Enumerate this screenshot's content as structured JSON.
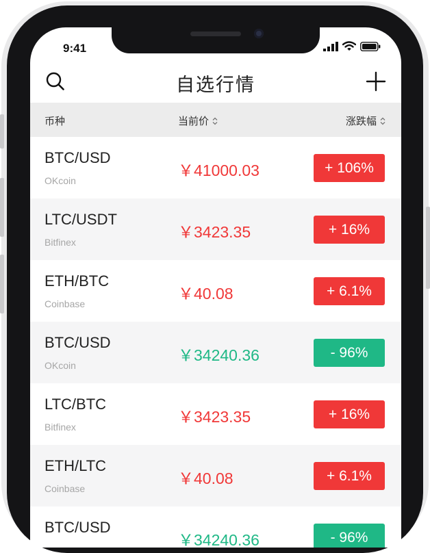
{
  "status": {
    "time": "9:41"
  },
  "nav": {
    "title": "自选行情"
  },
  "table_header": {
    "coin": "币种",
    "price": "当前价",
    "change": "涨跌幅"
  },
  "colors": {
    "up": "#f03838",
    "down": "#1fb886"
  },
  "rows": [
    {
      "pair": "BTC/USD",
      "exchange": "OKcoin",
      "price": "￥41000.03",
      "change": "+ 106%",
      "direction": "up"
    },
    {
      "pair": "LTC/USDT",
      "exchange": "Bitfinex",
      "price": "￥3423.35",
      "change": "+ 16%",
      "direction": "up"
    },
    {
      "pair": "ETH/BTC",
      "exchange": "Coinbase",
      "price": "￥40.08",
      "change": "+ 6.1%",
      "direction": "up"
    },
    {
      "pair": "BTC/USD",
      "exchange": "OKcoin",
      "price": "￥34240.36",
      "change": "- 96%",
      "direction": "down"
    },
    {
      "pair": "LTC/BTC",
      "exchange": "Bitfinex",
      "price": "￥3423.35",
      "change": "+ 16%",
      "direction": "up"
    },
    {
      "pair": "ETH/LTC",
      "exchange": "Coinbase",
      "price": "￥40.08",
      "change": "+ 6.1%",
      "direction": "up"
    },
    {
      "pair": "BTC/USD",
      "exchange": "",
      "price": "￥34240.36",
      "change": "- 96%",
      "direction": "down"
    }
  ]
}
